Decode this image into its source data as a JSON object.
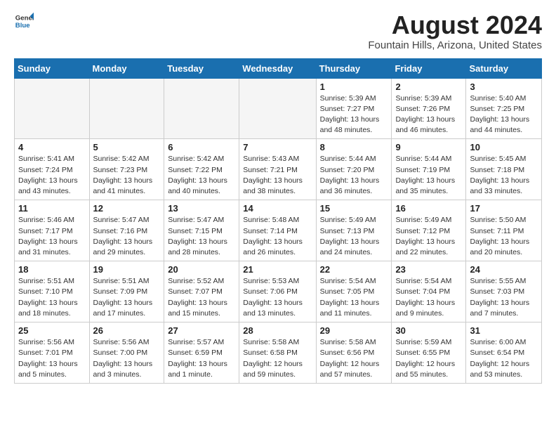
{
  "header": {
    "logo_general": "General",
    "logo_blue": "Blue",
    "month_year": "August 2024",
    "location": "Fountain Hills, Arizona, United States"
  },
  "calendar": {
    "days_of_week": [
      "Sunday",
      "Monday",
      "Tuesday",
      "Wednesday",
      "Thursday",
      "Friday",
      "Saturday"
    ],
    "weeks": [
      [
        {
          "day": "",
          "info": ""
        },
        {
          "day": "",
          "info": ""
        },
        {
          "day": "",
          "info": ""
        },
        {
          "day": "",
          "info": ""
        },
        {
          "day": "1",
          "info": "Sunrise: 5:39 AM\nSunset: 7:27 PM\nDaylight: 13 hours\nand 48 minutes."
        },
        {
          "day": "2",
          "info": "Sunrise: 5:39 AM\nSunset: 7:26 PM\nDaylight: 13 hours\nand 46 minutes."
        },
        {
          "day": "3",
          "info": "Sunrise: 5:40 AM\nSunset: 7:25 PM\nDaylight: 13 hours\nand 44 minutes."
        }
      ],
      [
        {
          "day": "4",
          "info": "Sunrise: 5:41 AM\nSunset: 7:24 PM\nDaylight: 13 hours\nand 43 minutes."
        },
        {
          "day": "5",
          "info": "Sunrise: 5:42 AM\nSunset: 7:23 PM\nDaylight: 13 hours\nand 41 minutes."
        },
        {
          "day": "6",
          "info": "Sunrise: 5:42 AM\nSunset: 7:22 PM\nDaylight: 13 hours\nand 40 minutes."
        },
        {
          "day": "7",
          "info": "Sunrise: 5:43 AM\nSunset: 7:21 PM\nDaylight: 13 hours\nand 38 minutes."
        },
        {
          "day": "8",
          "info": "Sunrise: 5:44 AM\nSunset: 7:20 PM\nDaylight: 13 hours\nand 36 minutes."
        },
        {
          "day": "9",
          "info": "Sunrise: 5:44 AM\nSunset: 7:19 PM\nDaylight: 13 hours\nand 35 minutes."
        },
        {
          "day": "10",
          "info": "Sunrise: 5:45 AM\nSunset: 7:18 PM\nDaylight: 13 hours\nand 33 minutes."
        }
      ],
      [
        {
          "day": "11",
          "info": "Sunrise: 5:46 AM\nSunset: 7:17 PM\nDaylight: 13 hours\nand 31 minutes."
        },
        {
          "day": "12",
          "info": "Sunrise: 5:47 AM\nSunset: 7:16 PM\nDaylight: 13 hours\nand 29 minutes."
        },
        {
          "day": "13",
          "info": "Sunrise: 5:47 AM\nSunset: 7:15 PM\nDaylight: 13 hours\nand 28 minutes."
        },
        {
          "day": "14",
          "info": "Sunrise: 5:48 AM\nSunset: 7:14 PM\nDaylight: 13 hours\nand 26 minutes."
        },
        {
          "day": "15",
          "info": "Sunrise: 5:49 AM\nSunset: 7:13 PM\nDaylight: 13 hours\nand 24 minutes."
        },
        {
          "day": "16",
          "info": "Sunrise: 5:49 AM\nSunset: 7:12 PM\nDaylight: 13 hours\nand 22 minutes."
        },
        {
          "day": "17",
          "info": "Sunrise: 5:50 AM\nSunset: 7:11 PM\nDaylight: 13 hours\nand 20 minutes."
        }
      ],
      [
        {
          "day": "18",
          "info": "Sunrise: 5:51 AM\nSunset: 7:10 PM\nDaylight: 13 hours\nand 18 minutes."
        },
        {
          "day": "19",
          "info": "Sunrise: 5:51 AM\nSunset: 7:09 PM\nDaylight: 13 hours\nand 17 minutes."
        },
        {
          "day": "20",
          "info": "Sunrise: 5:52 AM\nSunset: 7:07 PM\nDaylight: 13 hours\nand 15 minutes."
        },
        {
          "day": "21",
          "info": "Sunrise: 5:53 AM\nSunset: 7:06 PM\nDaylight: 13 hours\nand 13 minutes."
        },
        {
          "day": "22",
          "info": "Sunrise: 5:54 AM\nSunset: 7:05 PM\nDaylight: 13 hours\nand 11 minutes."
        },
        {
          "day": "23",
          "info": "Sunrise: 5:54 AM\nSunset: 7:04 PM\nDaylight: 13 hours\nand 9 minutes."
        },
        {
          "day": "24",
          "info": "Sunrise: 5:55 AM\nSunset: 7:03 PM\nDaylight: 13 hours\nand 7 minutes."
        }
      ],
      [
        {
          "day": "25",
          "info": "Sunrise: 5:56 AM\nSunset: 7:01 PM\nDaylight: 13 hours\nand 5 minutes."
        },
        {
          "day": "26",
          "info": "Sunrise: 5:56 AM\nSunset: 7:00 PM\nDaylight: 13 hours\nand 3 minutes."
        },
        {
          "day": "27",
          "info": "Sunrise: 5:57 AM\nSunset: 6:59 PM\nDaylight: 13 hours\nand 1 minute."
        },
        {
          "day": "28",
          "info": "Sunrise: 5:58 AM\nSunset: 6:58 PM\nDaylight: 12 hours\nand 59 minutes."
        },
        {
          "day": "29",
          "info": "Sunrise: 5:58 AM\nSunset: 6:56 PM\nDaylight: 12 hours\nand 57 minutes."
        },
        {
          "day": "30",
          "info": "Sunrise: 5:59 AM\nSunset: 6:55 PM\nDaylight: 12 hours\nand 55 minutes."
        },
        {
          "day": "31",
          "info": "Sunrise: 6:00 AM\nSunset: 6:54 PM\nDaylight: 12 hours\nand 53 minutes."
        }
      ]
    ]
  }
}
